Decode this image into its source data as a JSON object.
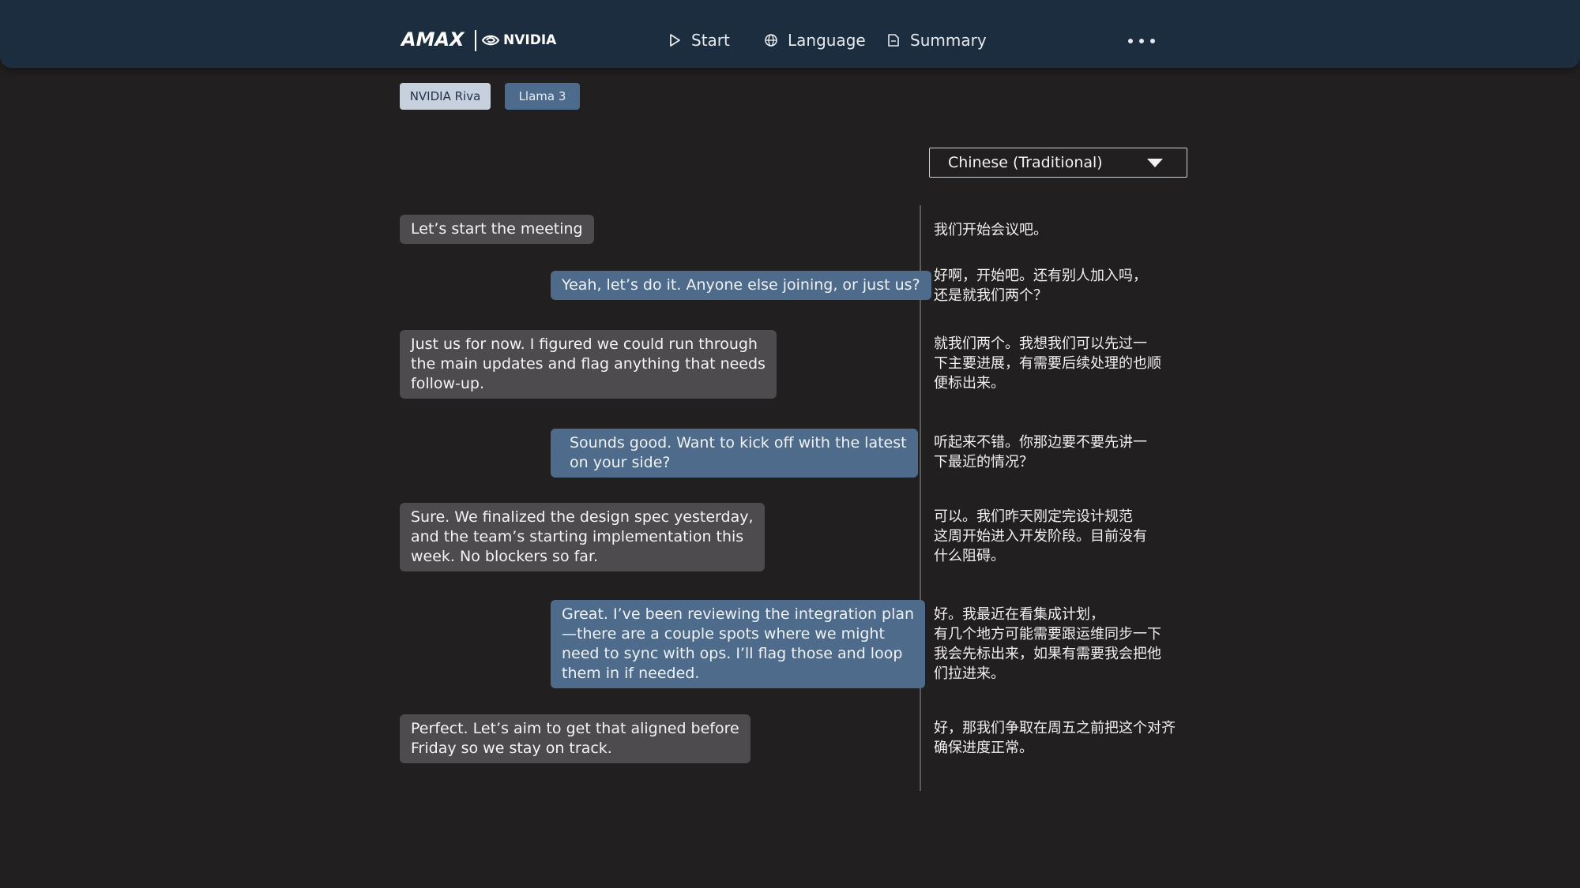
{
  "header": {
    "logo_amax": "AMAX",
    "logo_nvidia": "NVIDIA",
    "nav": [
      {
        "label": "Start",
        "icon": "play-icon"
      },
      {
        "label": "Language",
        "icon": "globe-icon"
      },
      {
        "label": "Summary",
        "icon": "document-icon"
      }
    ],
    "more_icon": "more-horizontal-icon"
  },
  "models": {
    "riva": "NVIDIA Riva",
    "llama": "Llama 3"
  },
  "language_select": {
    "value": "Chinese (Traditional)"
  },
  "conversation": [
    {
      "side": "left",
      "text": "Let’s start the meeting",
      "translation": "我们开始会议吧。"
    },
    {
      "side": "right",
      "text": "Yeah, let’s do it. Anyone else joining, or just us?",
      "translation": "好啊，开始吧。还有别人加入吗，\n还是就我们两个？"
    },
    {
      "side": "left",
      "text": "Just us for now. I figured we could run through\nthe main updates and flag anything that needs\nfollow-up.",
      "translation": "就我们两个。我想我们可以先过一\n下主要进展，有需要后续处理的也顺\n便标出来。"
    },
    {
      "side": "right",
      "text": "Sounds good. Want to kick off with the latest\non your side?",
      "translation": "听起来不错。你那边要不要先讲一\n下最近的情况？"
    },
    {
      "side": "left",
      "text": "Sure. We finalized the design spec yesterday,\nand the team’s starting implementation this\nweek. No blockers so far.",
      "translation": "可以。我们昨天刚定完设计规范\n这周开始进入开发阶段。目前没有\n什么阻碍。"
    },
    {
      "side": "right",
      "text": "Great. I’ve been reviewing the integration plan\n—there are a couple spots where we might\nneed to sync with ops. I’ll flag those and loop\nthem in if needed.",
      "translation": "好。我最近在看集成计划，\n有几个地方可能需要跟运维同步一下\n我会先标出来，如果有需要我会把他\n们拉进来。"
    },
    {
      "side": "left",
      "text": "Perfect. Let’s aim to get that aligned before\nFriday so we stay on track.",
      "translation": "好，那我们争取在周五之前把这个对齐\n确保进度正常。"
    }
  ],
  "colors": {
    "background": "#221f21",
    "topbar": "#1c2d3f",
    "bubble_left": "#4d4b4d",
    "bubble_right": "#4f6b8c"
  }
}
